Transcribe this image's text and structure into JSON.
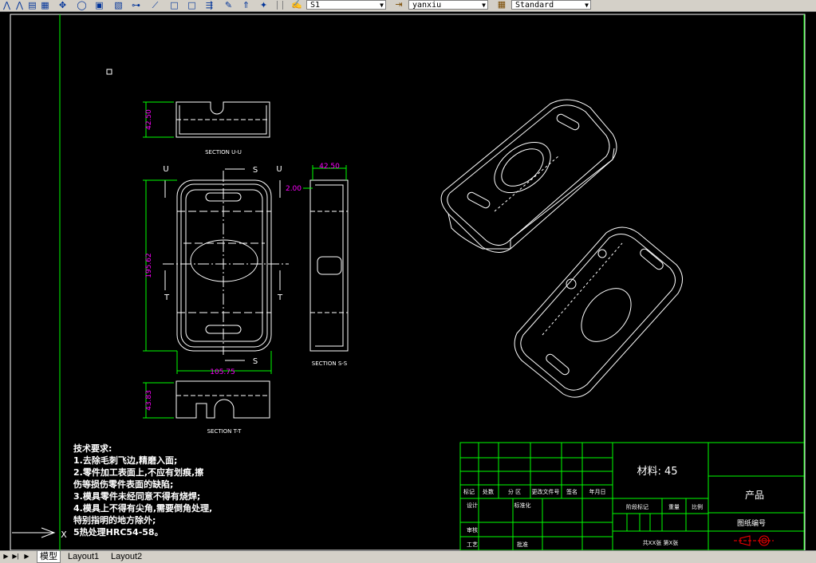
{
  "toolbar": {
    "icons": [
      "mirror-icon",
      "distance-icon",
      "properties-icon",
      "pan-icon",
      "orbit-icon",
      "layer-icon",
      "text-style-icon",
      "dimension-icon",
      "polyline-icon",
      "rectangle-icon",
      "rectangle-alt-icon",
      "move-icon",
      "pen-icon",
      "paint-icon"
    ],
    "style_combo": {
      "value": "S1"
    },
    "dimstyle_combo": {
      "value": "yanxiu"
    },
    "table_combo": {
      "value": "Standard"
    }
  },
  "drawing": {
    "sections": {
      "uu": "SECTION U-U",
      "ss": "SECTION S-S",
      "tt": "SECTION T-T"
    },
    "dimensions": {
      "d1": "42.50",
      "d2": "42.50",
      "d3": "2.00",
      "d4": "195.62",
      "d5": "105.75",
      "d6": "43.83"
    },
    "cut_labels": {
      "u_left": "U",
      "u_right": "U",
      "s_top": "S",
      "s_bottom": "S",
      "t_left": "T",
      "t_right": "T"
    },
    "notes": {
      "title": "技术要求:",
      "lines": [
        "1.去除毛刺飞边,精磨入面;",
        "2.零件加工表面上,不应有划痕,擦",
        "伤等损伤零件表面的缺陷;",
        "3.模具零件未经同意不得有烧焊;",
        "4.模具上不得有尖角,需要倒角处理,",
        "特别指明的地方除外;",
        "5热处理HRC54-58。"
      ]
    },
    "title_block": {
      "material": "材料: 45",
      "product": "产品",
      "drawing_no": "图纸编号",
      "sheets": "共XX张  第X张",
      "headers": [
        "标记",
        "处数",
        "分 区",
        "更改文件号",
        "签名",
        "年月日"
      ],
      "row_labels": [
        "设计",
        "标准化",
        "审核",
        "工艺",
        "批准"
      ],
      "stage_labels": [
        "阶段标记",
        "重量",
        "比例"
      ]
    }
  },
  "tabs": {
    "model": "模型",
    "layout1": "Layout1",
    "layout2": "Layout2"
  },
  "colors": {
    "background": "#000000",
    "lines": "#ffffff",
    "dimensions": "#00ff00",
    "dimension_text": "#ff00ff",
    "notes": "#ffffff",
    "ucs": "#ffffff"
  }
}
